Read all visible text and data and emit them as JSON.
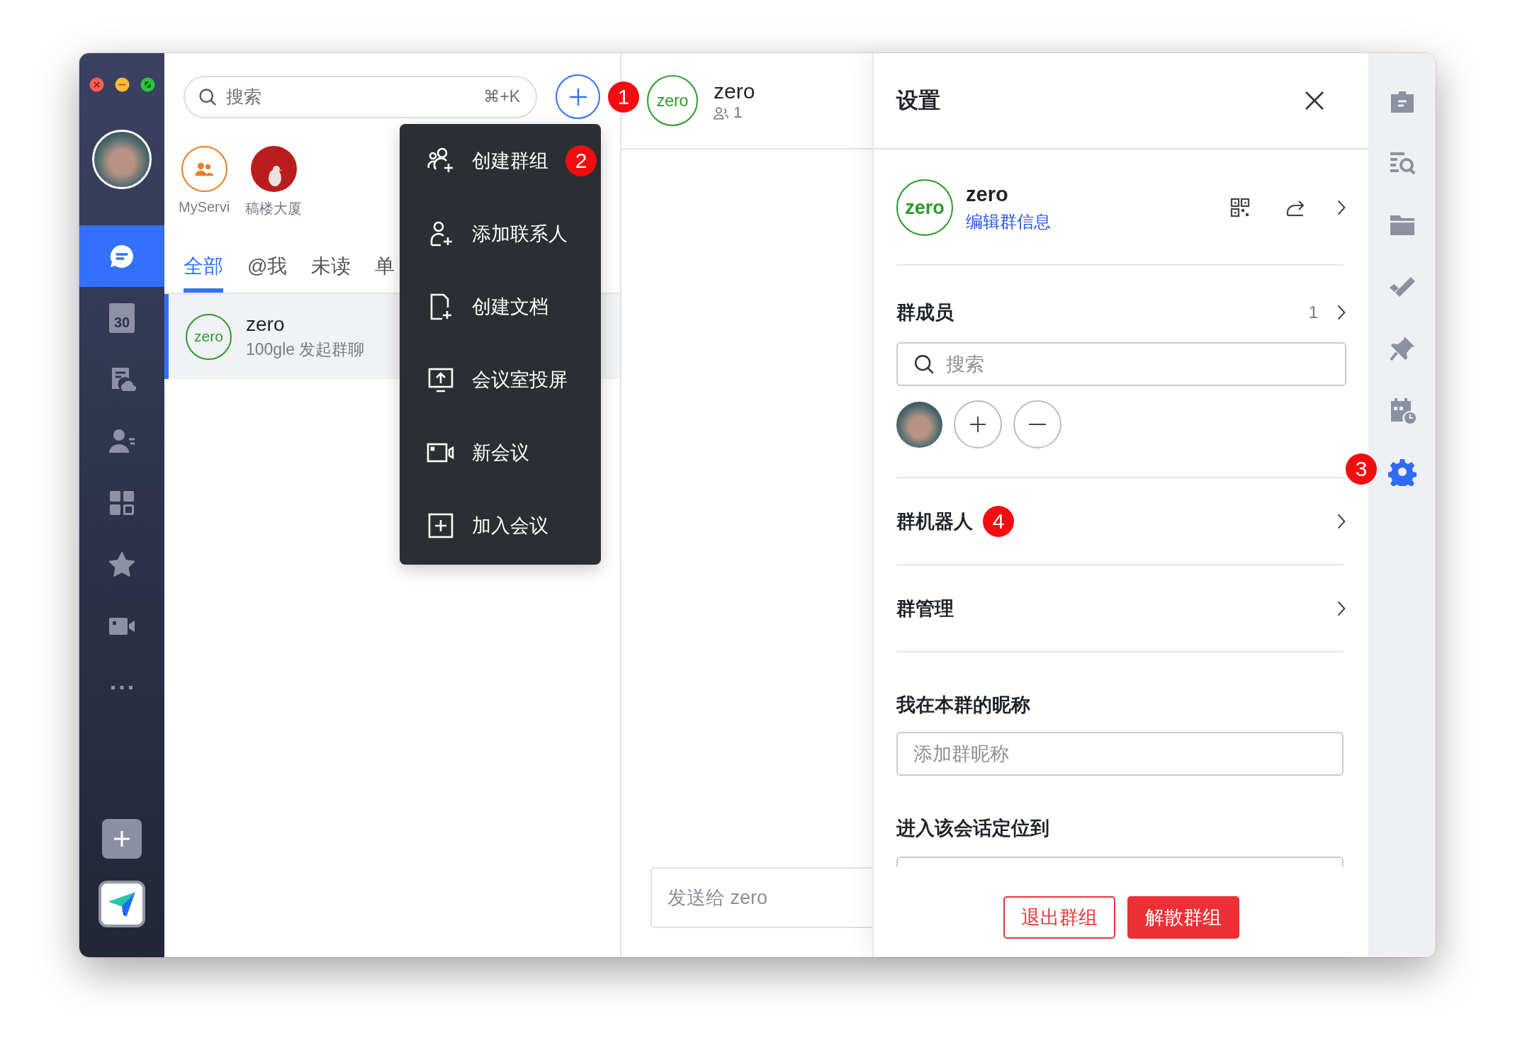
{
  "nav": {
    "items": [
      {
        "kind": "chat",
        "selected": true
      },
      {
        "kind": "calendar",
        "label": "30",
        "selected": false
      },
      {
        "kind": "docs",
        "selected": false
      },
      {
        "kind": "contacts",
        "selected": false
      },
      {
        "kind": "apps",
        "selected": false
      },
      {
        "kind": "favorites",
        "selected": false
      },
      {
        "kind": "video",
        "selected": false
      },
      {
        "kind": "more",
        "selected": false
      }
    ]
  },
  "search": {
    "placeholder": "搜索",
    "shortcut": "⌘+K"
  },
  "add_button": {
    "badge": "1"
  },
  "pinned": [
    {
      "kind": "group",
      "name": "MyServi"
    },
    {
      "kind": "logo",
      "name": "稿楼大厦"
    }
  ],
  "tabs": [
    {
      "label": "全部",
      "selected": true
    },
    {
      "label": "@我",
      "selected": false
    },
    {
      "label": "未读",
      "selected": false
    },
    {
      "label": "单",
      "selected": false
    }
  ],
  "conversations": [
    {
      "avatar_text": "zero",
      "name": "zero",
      "preview": "100gle 发起群聊",
      "selected": true
    }
  ],
  "add_menu": {
    "items": [
      {
        "kind": "create_group",
        "label": "创建群组",
        "badge": "2"
      },
      {
        "kind": "add_contact",
        "label": "添加联系人"
      },
      {
        "kind": "create_doc",
        "label": "创建文档"
      },
      {
        "kind": "screen_share",
        "label": "会议室投屏"
      },
      {
        "kind": "new_meeting",
        "label": "新会议"
      },
      {
        "kind": "join_meeting",
        "label": "加入会议"
      }
    ]
  },
  "chat": {
    "avatar_text": "zero",
    "title": "zero",
    "member_count": "1",
    "input_placeholder": "发送给 zero"
  },
  "settings": {
    "title": "设置",
    "group": {
      "avatar_text": "zero",
      "name": "zero",
      "edit_link": "编辑群信息"
    },
    "members": {
      "title": "群成员",
      "count": "1",
      "search_placeholder": "搜索"
    },
    "rows": [
      {
        "label": "群机器人",
        "badge": "4"
      },
      {
        "label": "群管理"
      }
    ],
    "nickname": {
      "label": "我在本群的昵称",
      "placeholder": "添加群昵称"
    },
    "locate": {
      "label": "进入该会话定位到"
    },
    "buttons": [
      {
        "kind": "outline",
        "label": "退出群组"
      },
      {
        "kind": "solid",
        "label": "解散群组"
      }
    ]
  },
  "rail": {
    "items": [
      {
        "kind": "briefcase",
        "selected": false
      },
      {
        "kind": "search_list",
        "selected": false
      },
      {
        "kind": "folder",
        "selected": false
      },
      {
        "kind": "check",
        "selected": false
      },
      {
        "kind": "pin",
        "selected": false
      },
      {
        "kind": "schedule",
        "selected": false
      },
      {
        "kind": "settings",
        "selected": true,
        "badge": "3"
      }
    ]
  }
}
